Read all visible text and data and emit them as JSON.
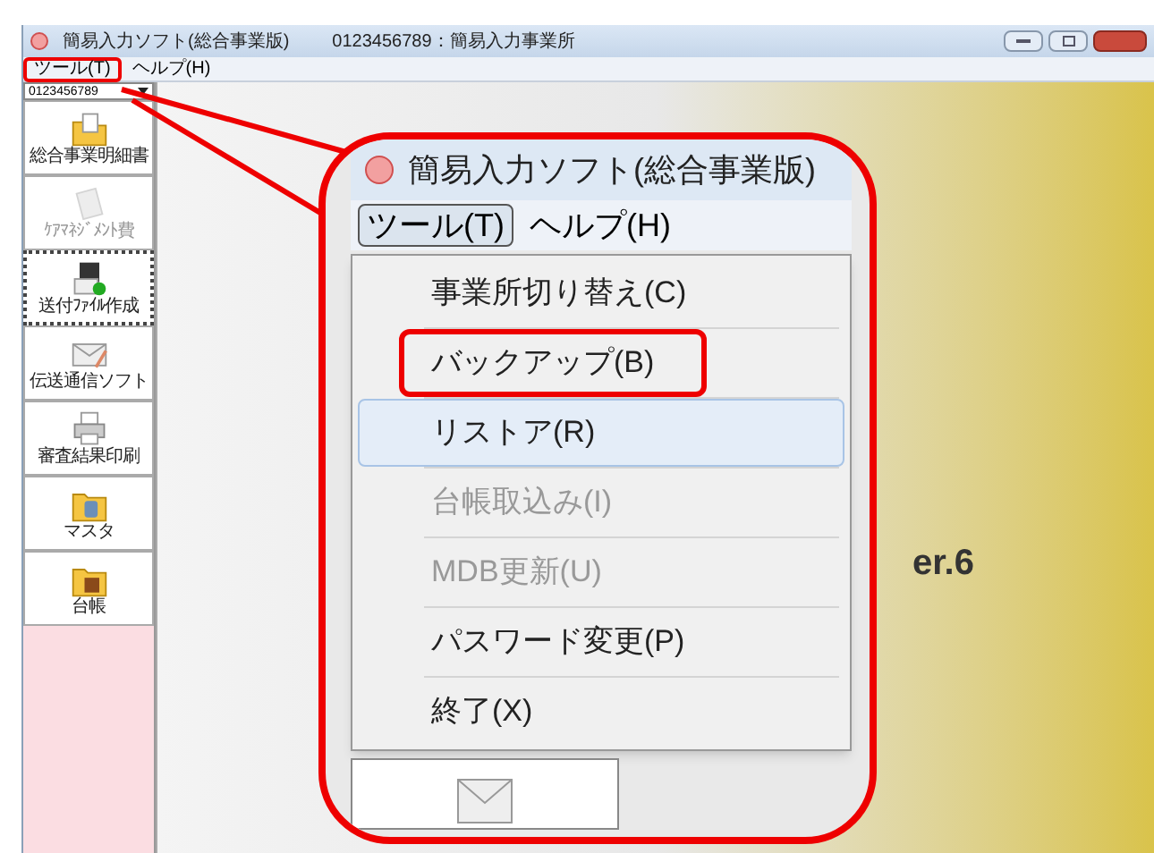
{
  "window": {
    "title": "簡易入力ソフト(総合事業版)",
    "office": "0123456789：簡易入力事業所"
  },
  "menubar": [
    {
      "label": "ツール(T)",
      "selected": false,
      "annotated": true
    },
    {
      "label": "ヘルプ(H)",
      "selected": false,
      "annotated": false
    }
  ],
  "office_select": {
    "value": "0123456789"
  },
  "sidebar": {
    "items": [
      {
        "label": "総合事業明細書",
        "kind": "folder",
        "selected": false,
        "disabled": false
      },
      {
        "label": "ｹｱﾏﾈｼﾞﾒﾝﾄ費",
        "kind": "paper",
        "selected": false,
        "disabled": true
      },
      {
        "label": "送付ﾌｧｲﾙ作成",
        "kind": "computer",
        "selected": true,
        "disabled": false
      },
      {
        "label": "伝送通信ソフト",
        "kind": "envelope",
        "selected": false,
        "disabled": false
      },
      {
        "label": "審査結果印刷",
        "kind": "printer",
        "selected": false,
        "disabled": false
      },
      {
        "label": "マスタ",
        "kind": "database",
        "selected": false,
        "disabled": false
      },
      {
        "label": "台帳",
        "kind": "box",
        "selected": false,
        "disabled": false
      }
    ]
  },
  "background": {
    "version_text": "er.6"
  },
  "callout": {
    "title": "簡易入力ソフト(総合事業版)",
    "menubar": [
      {
        "label": "ツール(T)",
        "selected": true
      },
      {
        "label": "ヘルプ(H)",
        "selected": false
      }
    ],
    "menu_items": [
      {
        "label": "事業所切り替え(C)",
        "disabled": false,
        "hovered": false,
        "annotated": false
      },
      {
        "label": "バックアップ(B)",
        "disabled": false,
        "hovered": false,
        "annotated": true
      },
      {
        "label": "リストア(R)",
        "disabled": false,
        "hovered": true,
        "annotated": false
      },
      {
        "label": "台帳取込み(I)",
        "disabled": true,
        "hovered": false,
        "annotated": false
      },
      {
        "label": "MDB更新(U)",
        "disabled": true,
        "hovered": false,
        "annotated": false
      },
      {
        "label": "パスワード変更(P)",
        "disabled": false,
        "hovered": false,
        "annotated": false
      },
      {
        "label": "終了(X)",
        "disabled": false,
        "hovered": false,
        "annotated": false
      }
    ]
  }
}
